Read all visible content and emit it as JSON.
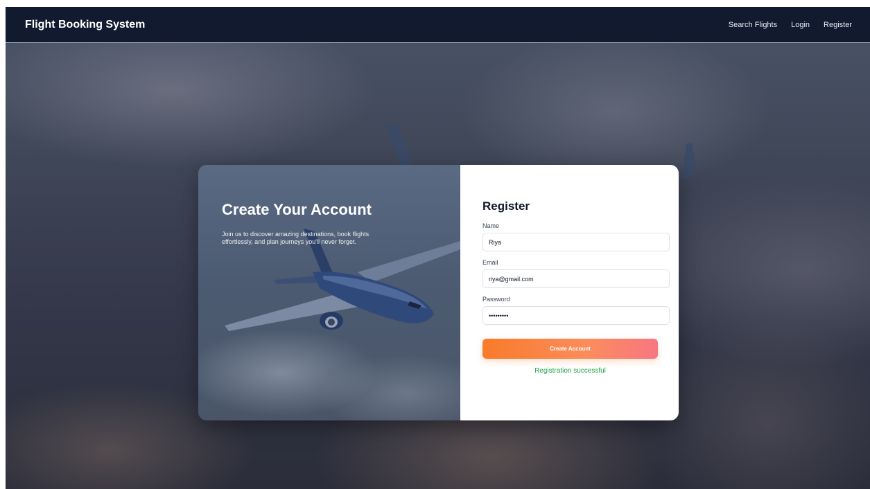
{
  "navbar": {
    "brand": "Flight Booking System",
    "links": [
      {
        "label": "Search Flights"
      },
      {
        "label": "Login"
      },
      {
        "label": "Register"
      }
    ]
  },
  "hero": {
    "title": "Create Your Account",
    "text": "Join us to discover amazing destinations, book flights effortlessly, and plan journeys you'll never forget."
  },
  "form": {
    "title": "Register",
    "name_label": "Name",
    "name_value": "Riya",
    "email_label": "Email",
    "email_value": "riya@gmail.com",
    "password_label": "Password",
    "password_value": "riya12345",
    "submit_label": "Create Account",
    "status_message": "Registration successful"
  },
  "colors": {
    "navbar_bg": "#121a2f",
    "button_gradient_start": "#f97b2a",
    "button_gradient_end": "#f87683",
    "success_text": "#22a447"
  }
}
